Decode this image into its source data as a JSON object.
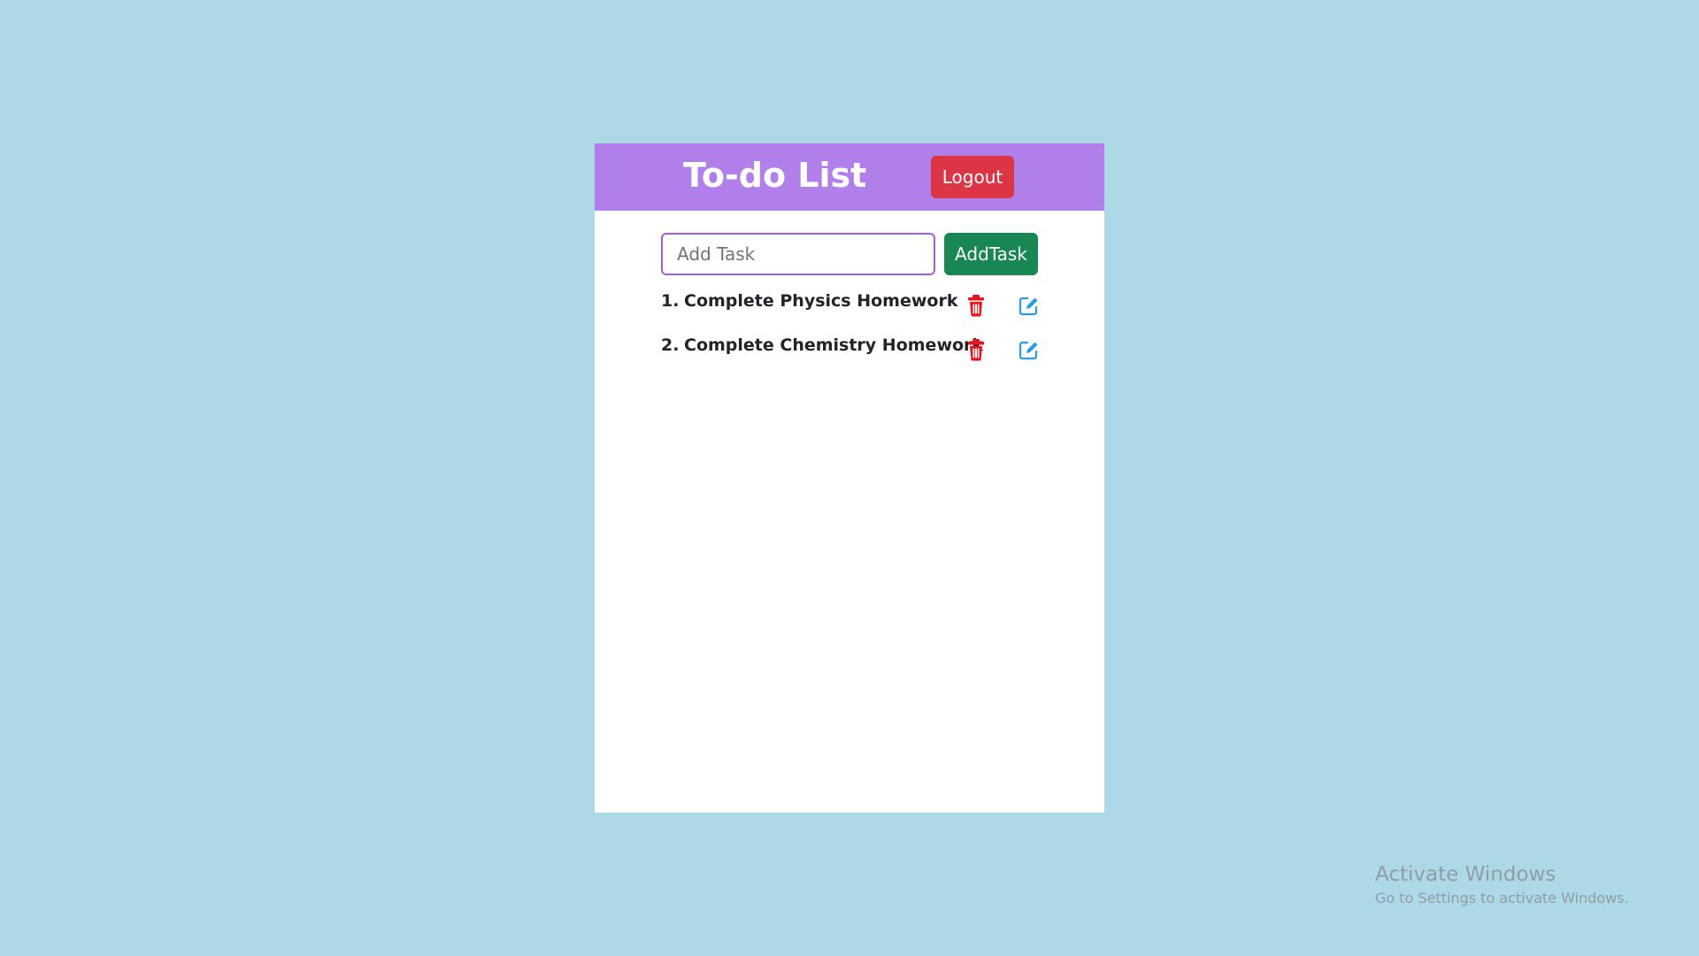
{
  "header": {
    "title": "To-do List",
    "logout_label": "Logout",
    "background_color": "#b07fea",
    "logout_color": "#dc3545"
  },
  "add_task": {
    "placeholder": "Add Task",
    "value": "",
    "button_label": "AddTask",
    "button_color": "#198754",
    "input_border_color": "#a35ee0"
  },
  "tasks": [
    {
      "number": "1.",
      "text": "Complete Physics Homework",
      "delete_icon": "trash-icon",
      "edit_icon": "edit-icon"
    },
    {
      "number": "2.",
      "text": "Complete Chemistry Homework",
      "delete_icon": "trash-icon",
      "edit_icon": "edit-icon"
    }
  ],
  "watermark": {
    "title": "Activate Windows",
    "subtitle": "Go to Settings to activate Windows."
  },
  "colors": {
    "page_background": "#add8e6",
    "delete_icon": "#e8131b",
    "edit_icon": "#2c9be6"
  }
}
